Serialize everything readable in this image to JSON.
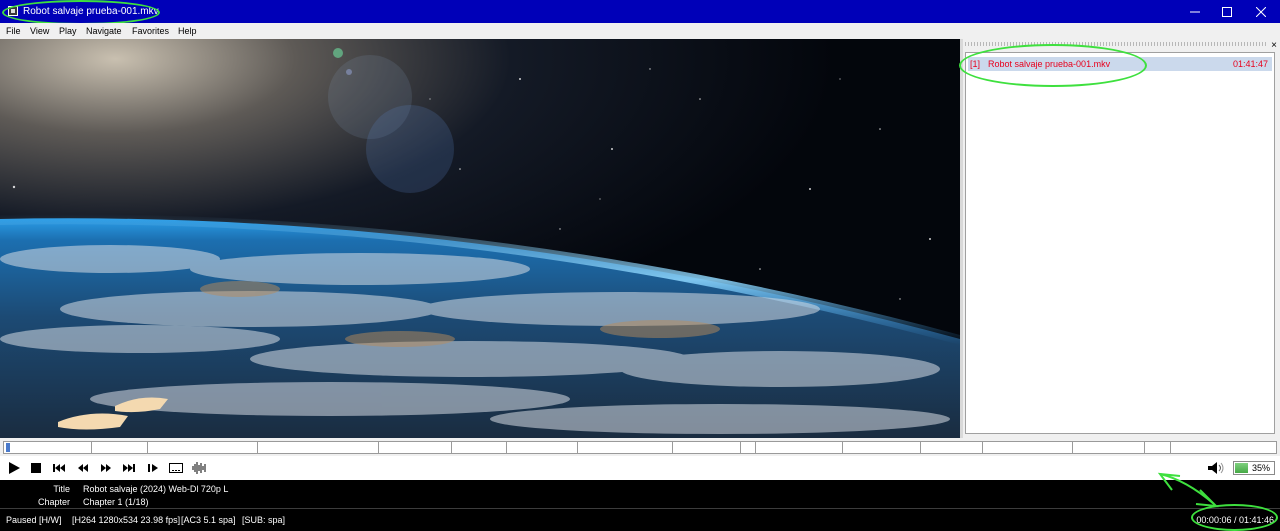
{
  "window": {
    "title": "Robot salvaje prueba-001.mkv",
    "minimize_icon": "minimize-icon",
    "maximize_icon": "maximize-icon",
    "close_icon": "close-icon"
  },
  "menu": [
    {
      "label": "File"
    },
    {
      "label": "View"
    },
    {
      "label": "Play"
    },
    {
      "label": "Navigate"
    },
    {
      "label": "Favorites"
    },
    {
      "label": "Help"
    }
  ],
  "playlist": {
    "close_label": "×",
    "items": [
      {
        "index": "[1]",
        "name": "Robot salvaje prueba-001.mkv",
        "duration": "01:41:47"
      }
    ]
  },
  "seekbar": {
    "position_fraction": 0.001
  },
  "controls": {
    "play_icon": "play-icon",
    "stop_icon": "stop-icon",
    "skip_back_icon": "skip-back-icon",
    "rewind_icon": "rewind-icon",
    "fast_forward_icon": "fast-forward-icon",
    "skip_forward_icon": "skip-forward-icon",
    "frame_step_icon": "frame-step-icon",
    "subtitles_icon": "subtitles-icon",
    "audio_waveform_icon": "audio-waveform-icon",
    "volume_icon": "speaker-icon",
    "volume_text": "35%",
    "volume_level": 0.35
  },
  "info": {
    "title_label": "Title",
    "title_value": "Robot salvaje (2024) Web-Dl 720p L",
    "chapter_label": "Chapter",
    "chapter_value": "Chapter 1 (1/18)"
  },
  "status": {
    "state": "Paused [H/W]",
    "video": "[H264 1280x534 23.98 fps]",
    "audio": "[AC3 5.1 spa]",
    "subs": "[SUB: spa]",
    "time": "00:00:06 / 01:41:46"
  },
  "colors": {
    "titlebar": "#0000b8",
    "playlist_item_text": "#e8001c",
    "playlist_item_bg": "#cbd9ec",
    "annotation": "#3ee03e",
    "volume_fill": "#45a945"
  }
}
